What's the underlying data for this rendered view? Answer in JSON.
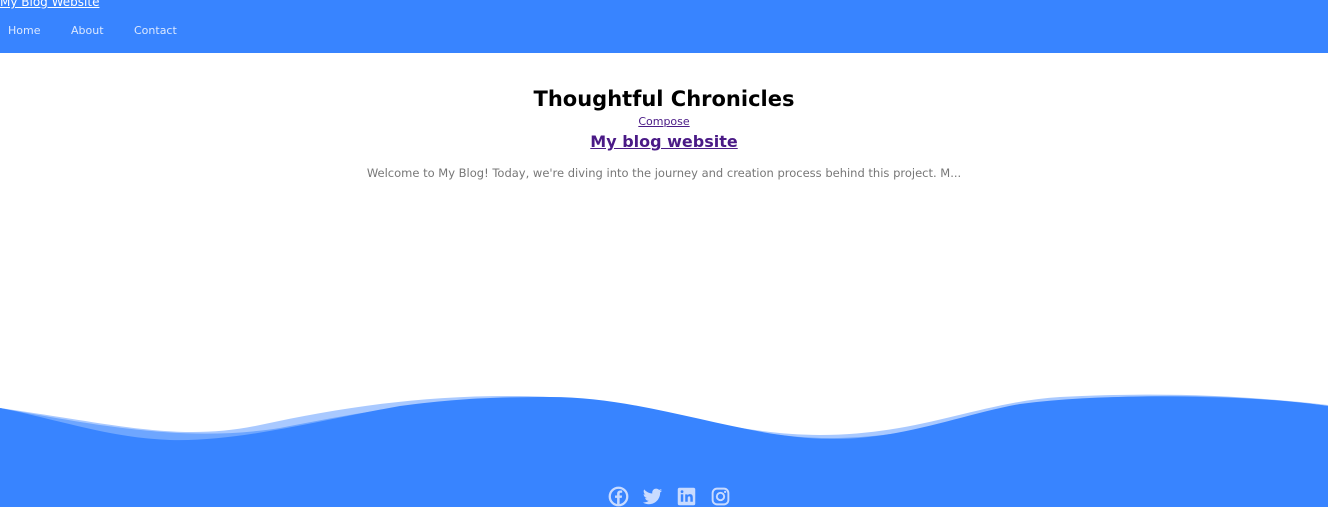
{
  "header": {
    "brand": "My Blog Website",
    "nav": [
      {
        "label": "Home"
      },
      {
        "label": "About"
      },
      {
        "label": "Contact"
      }
    ]
  },
  "main": {
    "site_title": "Thoughtful Chronicles",
    "compose_link": "Compose",
    "posts": [
      {
        "title": "My blog website",
        "excerpt": "Welcome to My Blog! Today, we're diving into the journey and creation process behind this project. M..."
      }
    ]
  },
  "footer": {
    "social_icons": [
      "facebook-icon",
      "twitter-icon",
      "linkedin-icon",
      "instagram-icon"
    ]
  },
  "colors": {
    "primary": "#3884ff",
    "link_visited": "#4a1a86",
    "excerpt_text": "#777777"
  }
}
